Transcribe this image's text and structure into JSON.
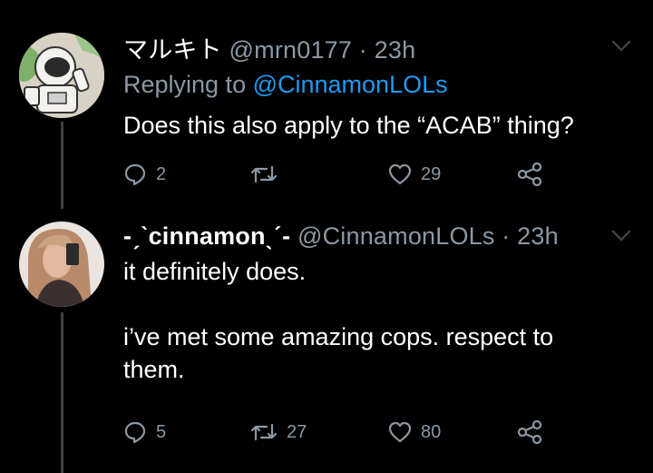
{
  "tweets": [
    {
      "display_name": "マルキト",
      "handle_time": "@mrn0177 · 23h",
      "reply_prefix": "Replying to ",
      "reply_mention": "@CinnamonLOLs",
      "text": "Does this also apply to the “ACAB” thing?",
      "actions": {
        "reply": "2",
        "retweet": "",
        "like": "29"
      },
      "avatar_icon": "astronaut-avatar"
    },
    {
      "display_name": "-ˏˋcinnamonˎˊ-",
      "handle_time": "@CinnamonLOLs · 23h",
      "text": "it definitely does.\n\ni’ve met some amazing cops. respect to\nthem.",
      "actions": {
        "reply": "5",
        "retweet": "27",
        "like": "80"
      },
      "avatar_icon": "selfie-avatar"
    }
  ],
  "colors": {
    "background": "#000000",
    "text": "#ffffff",
    "muted": "#8b98a5",
    "link": "#1d9bf0",
    "thread_line": "#3d4148"
  }
}
